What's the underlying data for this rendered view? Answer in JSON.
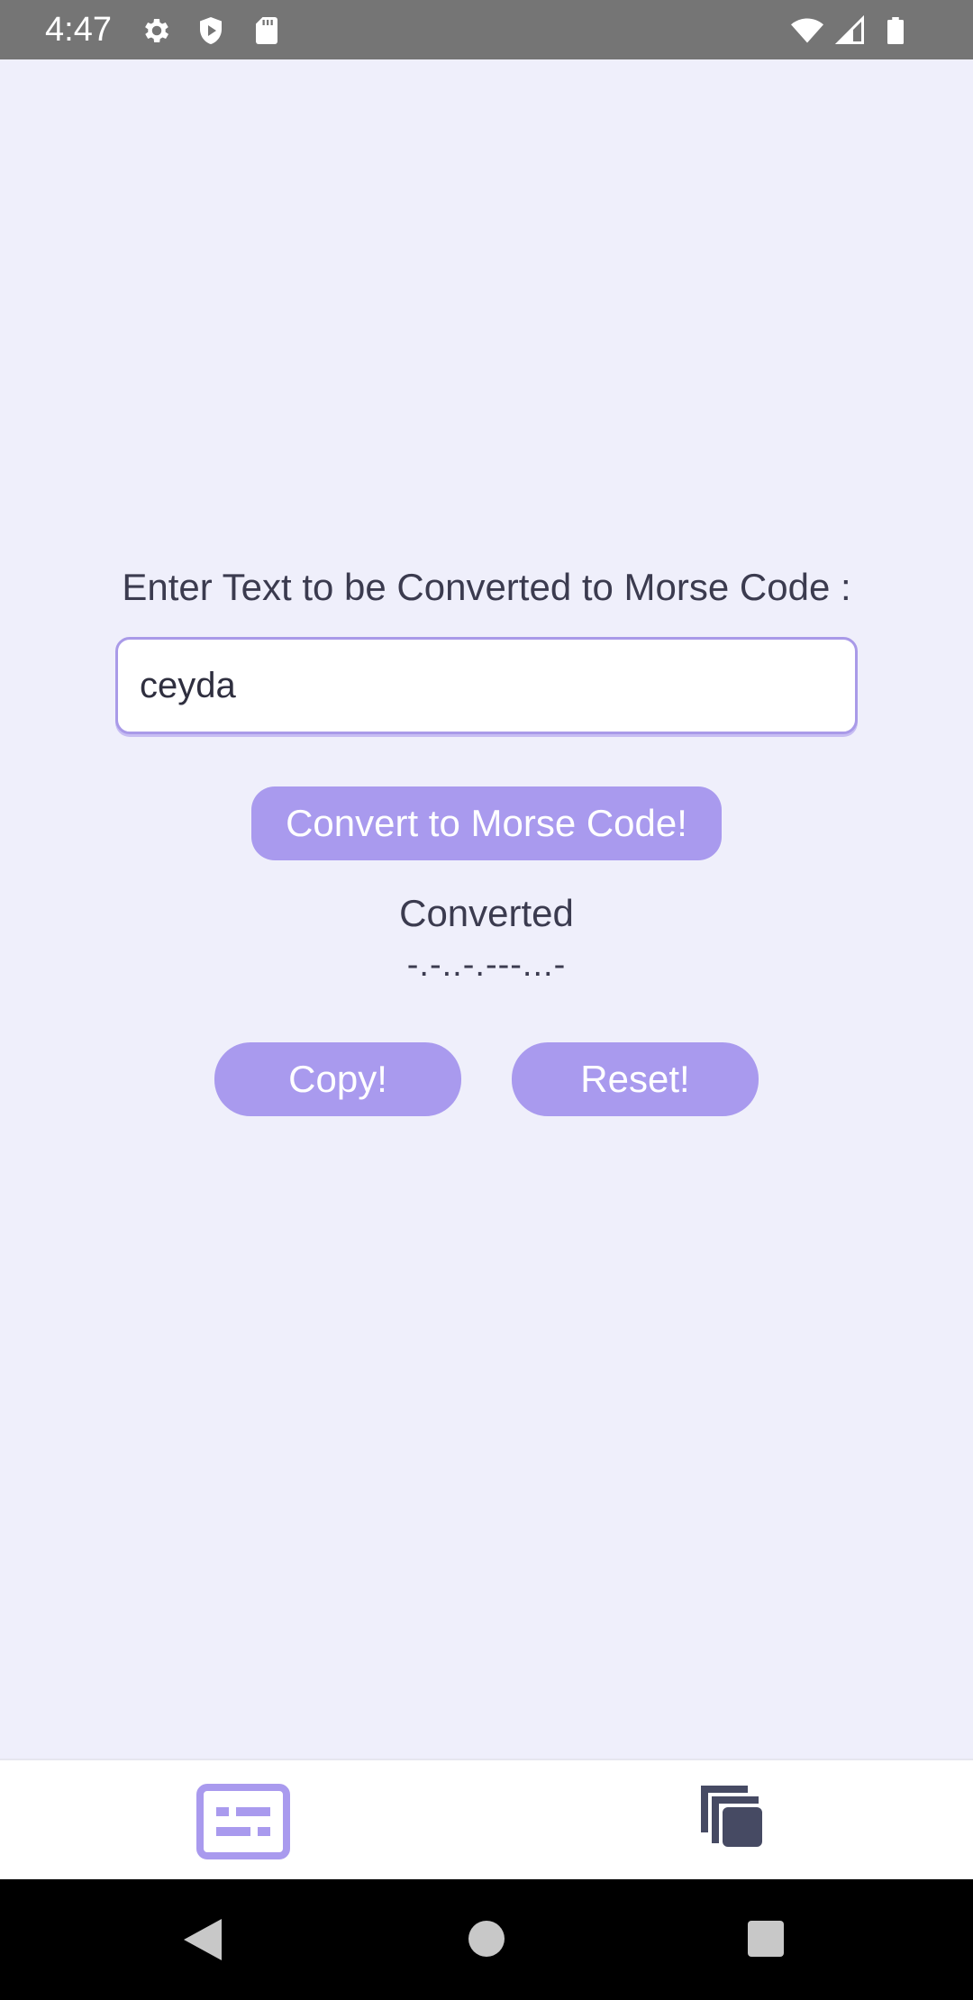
{
  "status_bar": {
    "time": "4:47",
    "icons": [
      "gear-icon",
      "shield-icon",
      "sd-card-icon",
      "wifi-icon",
      "signal-icon",
      "battery-icon"
    ]
  },
  "main": {
    "prompt": "Enter Text to be Converted to Morse Code :",
    "input_value": "ceyda",
    "convert_label": "Convert to Morse Code!",
    "converted_label": "Converted",
    "morse_result": "-.-..-.---...-",
    "copy_label": "Copy!",
    "reset_label": "Reset!"
  },
  "bottom_nav": {
    "items": [
      "converter-tab-icon",
      "copies-tab-icon"
    ]
  },
  "system_nav": [
    "back-icon",
    "home-icon",
    "recents-icon"
  ],
  "colors": {
    "accent": "#a99aee",
    "background": "#efeffb",
    "text": "#3b3b4f",
    "nav_active": "#a99aee",
    "nav_inactive": "#464a63"
  }
}
